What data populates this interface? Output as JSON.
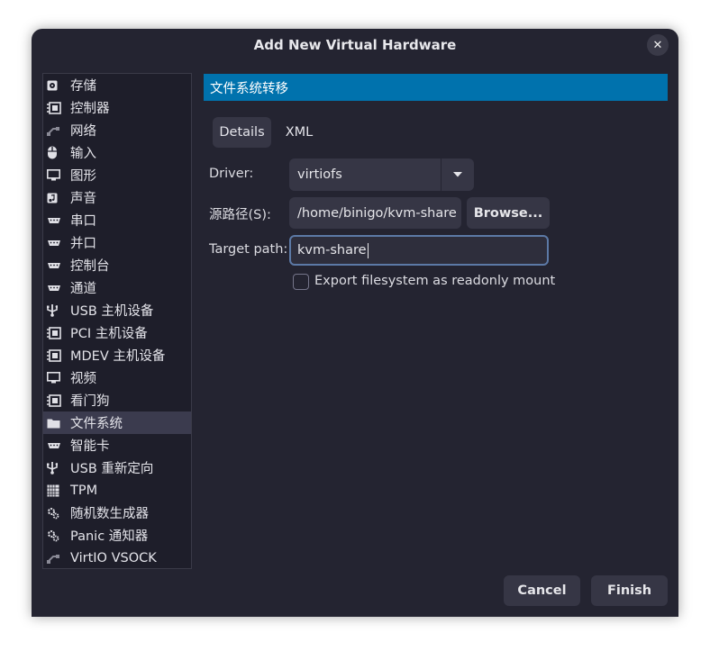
{
  "window": {
    "title": "Add New Virtual Hardware",
    "close_glyph": "✕"
  },
  "sidebar": {
    "items": [
      {
        "label": "存储",
        "icon": "storage-disk-icon"
      },
      {
        "label": "控制器",
        "icon": "controller-chip-icon"
      },
      {
        "label": "网络",
        "icon": "network-icon"
      },
      {
        "label": "输入",
        "icon": "mouse-icon"
      },
      {
        "label": "图形",
        "icon": "display-monitor-icon"
      },
      {
        "label": "声音",
        "icon": "sound-icon"
      },
      {
        "label": "串口",
        "icon": "serial-port-icon"
      },
      {
        "label": "并口",
        "icon": "parallel-port-icon"
      },
      {
        "label": "控制台",
        "icon": "console-port-icon"
      },
      {
        "label": "通道",
        "icon": "channel-port-icon"
      },
      {
        "label": "USB 主机设备",
        "icon": "usb-icon"
      },
      {
        "label": "PCI 主机设备",
        "icon": "pci-chip-icon"
      },
      {
        "label": "MDEV 主机设备",
        "icon": "mdev-chip-icon"
      },
      {
        "label": "视频",
        "icon": "video-monitor-icon"
      },
      {
        "label": "看门狗",
        "icon": "watchdog-chip-icon"
      },
      {
        "label": "文件系统",
        "icon": "folder-icon"
      },
      {
        "label": "智能卡",
        "icon": "smartcard-icon"
      },
      {
        "label": "USB 重新定向",
        "icon": "usb-redirect-icon"
      },
      {
        "label": "TPM",
        "icon": "tpm-chip-icon"
      },
      {
        "label": "随机数生成器",
        "icon": "rng-gear-icon"
      },
      {
        "label": "Panic 通知器",
        "icon": "panic-gear-icon"
      },
      {
        "label": "VirtIO VSOCK",
        "icon": "vsock-network-icon"
      }
    ],
    "selected_index": 15
  },
  "main": {
    "header": "文件系统转移",
    "tabs": [
      {
        "label": "Details",
        "active": true
      },
      {
        "label": "XML",
        "active": false
      }
    ],
    "driver": {
      "label": "Driver:",
      "value": "virtiofs"
    },
    "source": {
      "label": "源路径(S):",
      "value": "/home/binigo/kvm-share",
      "browse_label": "Browse..."
    },
    "target": {
      "label": "Target path:",
      "value": "kvm-share"
    },
    "readonly": {
      "label": "Export filesystem as readonly mount",
      "checked": false
    }
  },
  "footer": {
    "cancel_label": "Cancel",
    "finish_label": "Finish"
  },
  "colors": {
    "window_bg": "#242431",
    "accent_header": "#0072ad",
    "selected_row": "#3b3b4e",
    "focus_border": "#5c79a6"
  }
}
